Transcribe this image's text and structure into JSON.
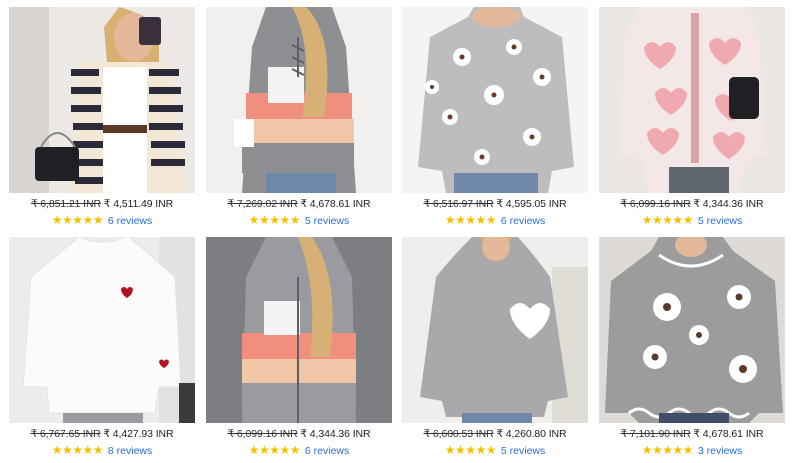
{
  "products": [
    {
      "old_price": "₹ 6,851.21 INR",
      "price": "₹ 4,511.49 INR",
      "reviews": "6 reviews",
      "rating": 5,
      "image": "striped-cardigan-photo",
      "bg": "#ece9e6",
      "primary": "#2a2a3a",
      "secondary": "#f2e8d5"
    },
    {
      "old_price": "₹ 7,269.02 INR",
      "price": "₹ 4,678.61 INR",
      "reviews": "5 reviews",
      "rating": 5,
      "image": "colorblock-hoodie-photo",
      "bg": "#f1f0ee",
      "primary": "#8e8f93",
      "secondary": "#f08f7e"
    },
    {
      "old_price": "₹ 6,516.97 INR",
      "price": "₹ 4,595.05 INR",
      "reviews": "6 reviews",
      "rating": 5,
      "image": "grey-flower-sweater-photo",
      "bg": "#f4f4f4",
      "primary": "#bdbdbd",
      "secondary": "#ffffff"
    },
    {
      "old_price": "₹ 6,099.16 INR",
      "price": "₹ 4,344.36 INR",
      "reviews": "5 reviews",
      "rating": 5,
      "image": "heart-cardigan-photo",
      "bg": "#e9e6e3",
      "primary": "#f4e7e7",
      "secondary": "#f0a9b0"
    },
    {
      "old_price": "₹ 6,767.65 INR",
      "price": "₹ 4,427.93 INR",
      "reviews": "8 reviews",
      "rating": 5,
      "image": "white-heart-sweater-photo",
      "bg": "#ececec",
      "primary": "#fbfbfb",
      "secondary": "#b3121f"
    },
    {
      "old_price": "₹ 6,099.16 INR",
      "price": "₹ 4,344.36 INR",
      "reviews": "6 reviews",
      "rating": 5,
      "image": "colorblock-zip-hoodie-photo",
      "bg": "#7d7e82",
      "primary": "#9a9ba0",
      "secondary": "#f08f7e"
    },
    {
      "old_price": "₹ 6,600.53 INR",
      "price": "₹ 4,260.80 INR",
      "reviews": "5 reviews",
      "rating": 5,
      "image": "grey-heart-sweater-photo",
      "bg": "#efeeec",
      "primary": "#a9a9ab",
      "secondary": "#ffffff"
    },
    {
      "old_price": "₹ 7,101.90 INR",
      "price": "₹ 4,678.61 INR",
      "reviews": "3 reviews",
      "rating": 5,
      "image": "grey-flower-wave-sweater-photo",
      "bg": "#dedbd7",
      "primary": "#9d9c9c",
      "secondary": "#ffffff"
    }
  ]
}
